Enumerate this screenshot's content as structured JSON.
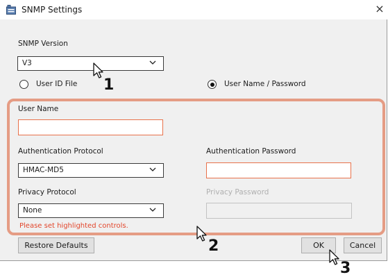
{
  "window": {
    "title": "SNMP Settings",
    "close_glyph": "×"
  },
  "snmp_version": {
    "label": "SNMP Version",
    "value": "V3"
  },
  "auth_mode": {
    "options": [
      "User ID File",
      "User Name / Password"
    ],
    "selected": "User Name / Password"
  },
  "user_name": {
    "label": "User Name",
    "value": ""
  },
  "auth_protocol": {
    "label": "Authentication Protocol",
    "value": "HMAC-MD5"
  },
  "auth_password": {
    "label": "Authentication Password",
    "value": ""
  },
  "privacy_protocol": {
    "label": "Privacy Protocol",
    "value": "None"
  },
  "privacy_password": {
    "label": "Privacy Password",
    "value": ""
  },
  "error_message": "Please set highlighted controls.",
  "buttons": {
    "restore": "Restore Defaults",
    "ok": "OK",
    "cancel": "Cancel"
  },
  "step_callouts": [
    "1",
    "2",
    "3"
  ],
  "colors": {
    "highlight": "#e59c84",
    "error_text": "#e2452a",
    "error_border": "#e8714a"
  },
  "icons": {
    "app": "settings-window-icon",
    "dropdown": "chevron-down-icon",
    "pointer": "mouse-cursor-icon"
  }
}
